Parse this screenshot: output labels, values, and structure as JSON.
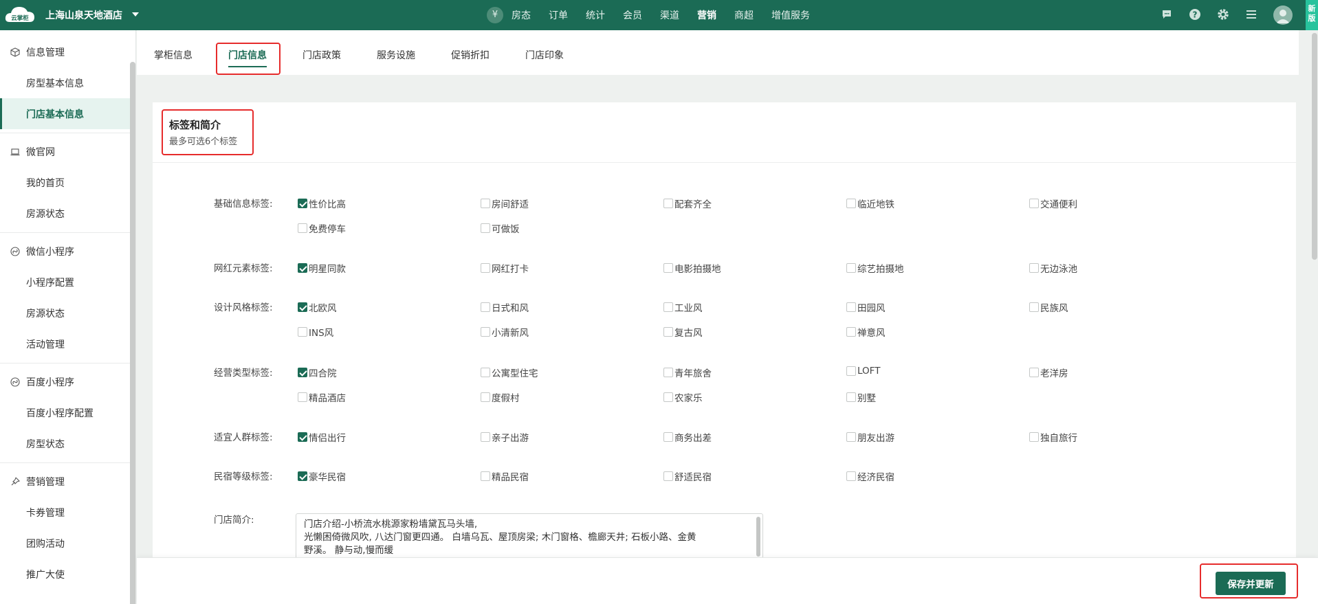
{
  "header": {
    "logo_text": "云掌柜",
    "hotel_name": "上海山泉天地酒店",
    "home_icon": "yen-icon",
    "nav": [
      "房态",
      "订单",
      "统计",
      "会员",
      "渠道",
      "营销",
      "商超",
      "增值服务"
    ],
    "nav_active": "营销",
    "icons": [
      "message-icon",
      "help-icon",
      "gear-icon",
      "menu-icon"
    ],
    "new_badge": "新版"
  },
  "sidebar": {
    "groups": [
      {
        "label": "信息管理",
        "icon": "cube-icon",
        "items": [
          "房型基本信息",
          "门店基本信息"
        ]
      },
      {
        "label": "微官网",
        "icon": "laptop-icon",
        "items": [
          "我的首页",
          "房源状态"
        ]
      },
      {
        "label": "微信小程序",
        "icon": "miniprogram-icon",
        "items": [
          "小程序配置",
          "房源状态",
          "活动管理"
        ]
      },
      {
        "label": "百度小程序",
        "icon": "miniprogram-icon",
        "items": [
          "百度小程序配置",
          "房型状态"
        ]
      },
      {
        "label": "营销管理",
        "icon": "pin-icon",
        "items": [
          "卡券管理",
          "团购活动",
          "推广大使"
        ]
      }
    ],
    "active_item": "门店基本信息"
  },
  "tabs": [
    "掌柜信息",
    "门店信息",
    "门店政策",
    "服务设施",
    "促销折扣",
    "门店印象"
  ],
  "tab_active": "门店信息",
  "card": {
    "title": "标签和简介",
    "subtitle": "最多可选6个标签"
  },
  "tag_groups": [
    {
      "label": "基础信息标签:",
      "options": [
        {
          "text": "性价比高",
          "checked": true
        },
        {
          "text": "房间舒适",
          "checked": false
        },
        {
          "text": "配套齐全",
          "checked": false
        },
        {
          "text": "临近地铁",
          "checked": false
        },
        {
          "text": "交通便利",
          "checked": false
        },
        {
          "text": "免费停车",
          "checked": false
        },
        {
          "text": "可做饭",
          "checked": false
        }
      ]
    },
    {
      "label": "网红元素标签:",
      "options": [
        {
          "text": "明星同款",
          "checked": true
        },
        {
          "text": "网红打卡",
          "checked": false
        },
        {
          "text": "电影拍摄地",
          "checked": false
        },
        {
          "text": "综艺拍摄地",
          "checked": false
        },
        {
          "text": "无边泳池",
          "checked": false
        }
      ]
    },
    {
      "label": "设计风格标签:",
      "options": [
        {
          "text": "北欧风",
          "checked": true
        },
        {
          "text": "日式和风",
          "checked": false
        },
        {
          "text": "工业风",
          "checked": false
        },
        {
          "text": "田园风",
          "checked": false
        },
        {
          "text": "民族风",
          "checked": false
        },
        {
          "text": "INS风",
          "checked": false
        },
        {
          "text": "小清新风",
          "checked": false
        },
        {
          "text": "复古风",
          "checked": false
        },
        {
          "text": "禅意风",
          "checked": false
        }
      ]
    },
    {
      "label": "经营类型标签:",
      "options": [
        {
          "text": "四合院",
          "checked": true
        },
        {
          "text": "公寓型住宅",
          "checked": false
        },
        {
          "text": "青年旅舍",
          "checked": false
        },
        {
          "text": "LOFT",
          "checked": false
        },
        {
          "text": "老洋房",
          "checked": false
        },
        {
          "text": "精品酒店",
          "checked": false
        },
        {
          "text": "度假村",
          "checked": false
        },
        {
          "text": "农家乐",
          "checked": false
        },
        {
          "text": "别墅",
          "checked": false
        }
      ]
    },
    {
      "label": "适宜人群标签:",
      "options": [
        {
          "text": "情侣出行",
          "checked": true
        },
        {
          "text": "亲子出游",
          "checked": false
        },
        {
          "text": "商务出差",
          "checked": false
        },
        {
          "text": "朋友出游",
          "checked": false
        },
        {
          "text": "独自旅行",
          "checked": false
        }
      ]
    },
    {
      "label": "民宿等级标签:",
      "options": [
        {
          "text": "豪华民宿",
          "checked": true
        },
        {
          "text": "精品民宿",
          "checked": false
        },
        {
          "text": "舒适民宿",
          "checked": false
        },
        {
          "text": "经济民宿",
          "checked": false
        }
      ]
    }
  ],
  "intro": {
    "label": "门店简介:",
    "lines": [
      "门店介绍-小桥流水桃源家粉墙黛瓦马头墙,",
      "光懒困倚微风吹, 八达门窗更四通。 白墙乌瓦、屋顶房梁; 木门窗格、檐廊天井; 石板小路、金黄",
      "野溪。 静与动,慢而缓"
    ]
  },
  "footer": {
    "save_label": "保存并更新"
  }
}
